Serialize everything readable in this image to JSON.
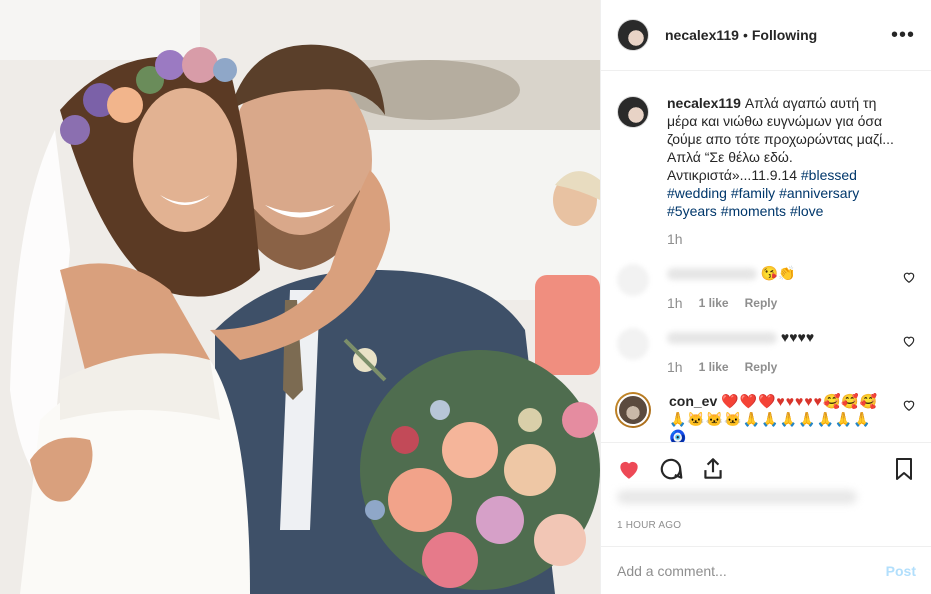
{
  "post": {
    "username": "necalex119",
    "separator": "•",
    "follow_status": "Following",
    "more_glyph": "•••"
  },
  "caption": {
    "username": "necalex119",
    "text": "Απλά αγαπώ αυτή τη μέρα και νιώθω ευγνώμων για όσα ζούμε απο τότε προχωρώντας μαζί... Απλά “Σε θέλω εδώ. Αντικριστά»...11.9.14",
    "tags": [
      "#blessed",
      "#wedding",
      "#family",
      "#anniversary",
      "#5years",
      "#moments",
      "#love"
    ],
    "time": "1h"
  },
  "comments": [
    {
      "text_suffix": "😘👏",
      "time": "1h",
      "likes": "1 like",
      "reply": "Reply"
    },
    {
      "text_suffix": "♥♥♥♥",
      "time": "1h",
      "likes": "1 like",
      "reply": "Reply"
    },
    {
      "username": "con_ev",
      "text": "❤️❤️❤️♥♥♥♥♥🥰🥰🥰 🙏🐱🐱🐱🙏🙏🙏🙏🙏🙏🙏🧿"
    }
  ],
  "timestamp": "1 HOUR AGO",
  "add_comment": {
    "placeholder": "Add a comment...",
    "post_label": "Post"
  },
  "icons": {
    "like": "heart-filled-icon",
    "comment": "comment-icon",
    "share": "share-icon",
    "save": "bookmark-icon",
    "more": "more-icon"
  },
  "colors": {
    "like_red": "#ed4956",
    "hashtag": "#00376b",
    "muted": "#8e8e8e",
    "post_disabled": "#b2dffc"
  }
}
